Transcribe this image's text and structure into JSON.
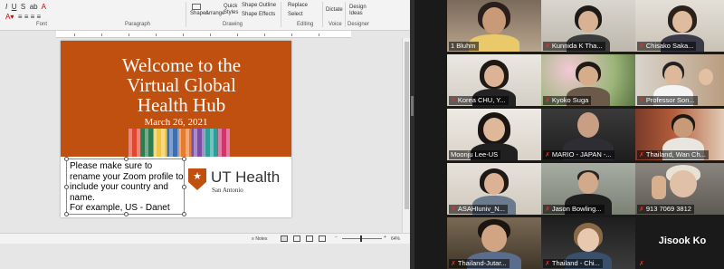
{
  "ribbon": {
    "font_group": "Font",
    "paragraph_group": "Paragraph",
    "drawing_group": "Drawing",
    "editing_group": "Editing",
    "voice_group": "Voice",
    "designer_group": "Designer",
    "shapes_label": "Shapes",
    "arrange_label": "Arrange",
    "quick_styles_label": "Quick Styles",
    "shape_outline_label": "Shape Outline",
    "shape_effects_label": "Shape Effects",
    "replace_label": "Replace",
    "select_label": "Select",
    "dictate_label": "Dictate",
    "design_ideas_label": "Design Ideas"
  },
  "slide": {
    "title_line1": "Welcome to the",
    "title_line2": "Virtual Global",
    "title_line3": "Health Hub",
    "date": "March 26, 2021",
    "textbox": "Please make sure to rename your Zoom profile to include your country and name.",
    "textbox_example": "For example, US - Danet",
    "logo_main": "UT Health",
    "logo_sub": "San Antonio"
  },
  "statusbar": {
    "notes": "Notes",
    "zoom": "64%"
  },
  "participants": [
    {
      "name": "1 Bluhm",
      "muted": false,
      "active": true
    },
    {
      "name": "Kunnida K Tha...",
      "muted": true,
      "active": false
    },
    {
      "name": "Chisako Saka...",
      "muted": true,
      "active": false
    },
    {
      "name": "Korea CHU, Y...",
      "muted": true,
      "active": false
    },
    {
      "name": "Kyoko Suga",
      "muted": true,
      "active": false
    },
    {
      "name": "Professor Son...",
      "muted": true,
      "active": false
    },
    {
      "name": "Moonju Lee-US",
      "muted": true,
      "active": false
    },
    {
      "name": "MARIO - JAPAN -...",
      "muted": true,
      "active": false
    },
    {
      "name": "Thailand, Wan Ch...",
      "muted": true,
      "active": false
    },
    {
      "name": "ASAHIuniv_N...",
      "muted": true,
      "active": false
    },
    {
      "name": "Jason Bowling...",
      "muted": true,
      "active": false
    },
    {
      "name": "913 7069 3812",
      "muted": true,
      "active": false
    },
    {
      "name": "Thailand-Jutar...",
      "muted": true,
      "active": false
    },
    {
      "name": "Thailand - Chi...",
      "muted": true,
      "active": false
    },
    {
      "name": "Jisook Ko",
      "muted": true,
      "active": false
    }
  ],
  "colors": {
    "slide_header": "#bf5010",
    "active_speaker": "#c7d62e",
    "muted_icon": "#e0322f"
  }
}
